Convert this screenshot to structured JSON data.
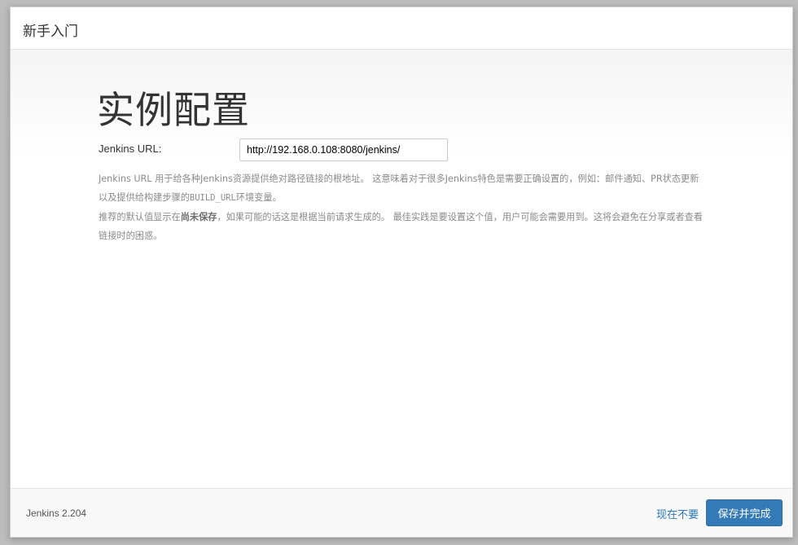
{
  "header": {
    "title": "新手入门"
  },
  "main": {
    "heading": "实例配置",
    "url_label": "Jenkins URL:",
    "url_value": "http://192.168.0.108:8080/jenkins/",
    "help": {
      "p1_a": "Jenkins URL 用于给各种Jenkins资源提供绝对路径链接的根地址。 这意味着对于很多Jenkins特色是需要正确设置的，例如：邮件通知、PR状态更新以及提供给构建步骤的",
      "p1_code": "BUILD_URL",
      "p1_b": "环境变量。",
      "p2_a": "推荐的默认值显示在",
      "p2_strong": "尚未保存",
      "p2_b": "，如果可能的话这是根据当前请求生成的。 最佳实践是要设置这个值，用户可能会需要用到。这将会避免在分享或者查看链接时的困惑。"
    }
  },
  "footer": {
    "version": "Jenkins 2.204",
    "skip_label": "现在不要",
    "save_label": "保存并完成"
  },
  "colors": {
    "primary_button": "#337ab7",
    "link": "#2a78c2",
    "help_text": "#8a8a8a"
  }
}
